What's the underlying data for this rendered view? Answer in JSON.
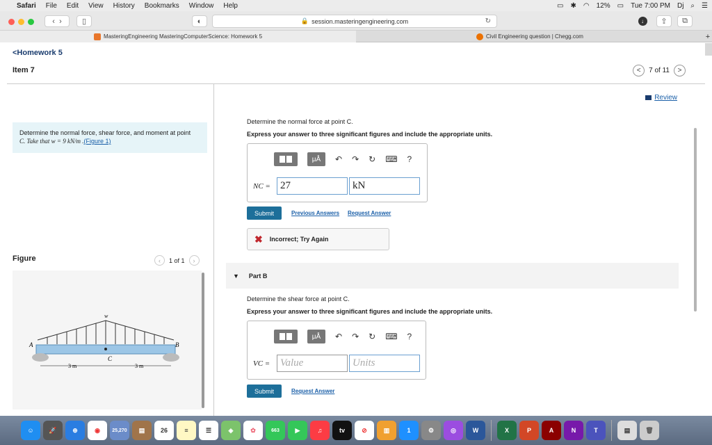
{
  "menubar": {
    "apple": "",
    "app": "Safari",
    "items": [
      "File",
      "Edit",
      "View",
      "History",
      "Bookmarks",
      "Window",
      "Help"
    ],
    "battery": "12%",
    "clock": "Tue 7:00 PM",
    "user": "Dj"
  },
  "browser": {
    "url": "session.masteringengineering.com",
    "tabs": [
      {
        "label": "MasteringEngineering MasteringComputerScience: Homework 5",
        "favicon_color": "#e8762b"
      },
      {
        "label": "Civil Engineering question | Chegg.com",
        "favicon_color": "#eb7100"
      }
    ],
    "new_tab": "+"
  },
  "header": {
    "back_link": "<Homework 5",
    "item": "Item 7",
    "pager_text": "7 of 11",
    "prev": "<",
    "next": ">"
  },
  "problem": {
    "text_1": "Determine the normal force, shear force, and moment at point",
    "text_2": "C. Take that w = 9 kN/m .",
    "figure_link": "(Figure 1)"
  },
  "figure": {
    "label": "Figure",
    "pager": "1 of 1",
    "labels": {
      "w": "w",
      "A": "A",
      "B": "B",
      "C": "C",
      "d1": "3 m",
      "d2": "3 m"
    }
  },
  "review": "Review",
  "partA": {
    "question": "Determine the normal force at point C.",
    "instruction": "Express your answer to three significant figures and include the appropriate units.",
    "var_label": "NC =",
    "value": "27",
    "units": "kN",
    "submit": "Submit",
    "prev_answers": "Previous Answers",
    "request_answer": "Request Answer",
    "feedback": "Incorrect; Try Again"
  },
  "partB": {
    "title": "Part B",
    "question": "Determine the shear force at point C.",
    "instruction": "Express your answer to three significant figures and include the appropriate units.",
    "var_label": "VC =",
    "value_placeholder": "Value",
    "units_placeholder": "Units",
    "submit": "Submit",
    "request_answer": "Request Answer"
  },
  "toolbar_glyphs": {
    "mu": "μÅ",
    "undo": "↶",
    "redo": "↷",
    "reset": "↻",
    "keyboard": "⌨",
    "help": "?"
  },
  "dock": {
    "badges": {
      "photos": "25,270",
      "calendar_day": "26",
      "messages": "663",
      "appstore": "1"
    },
    "tv": "tv"
  }
}
